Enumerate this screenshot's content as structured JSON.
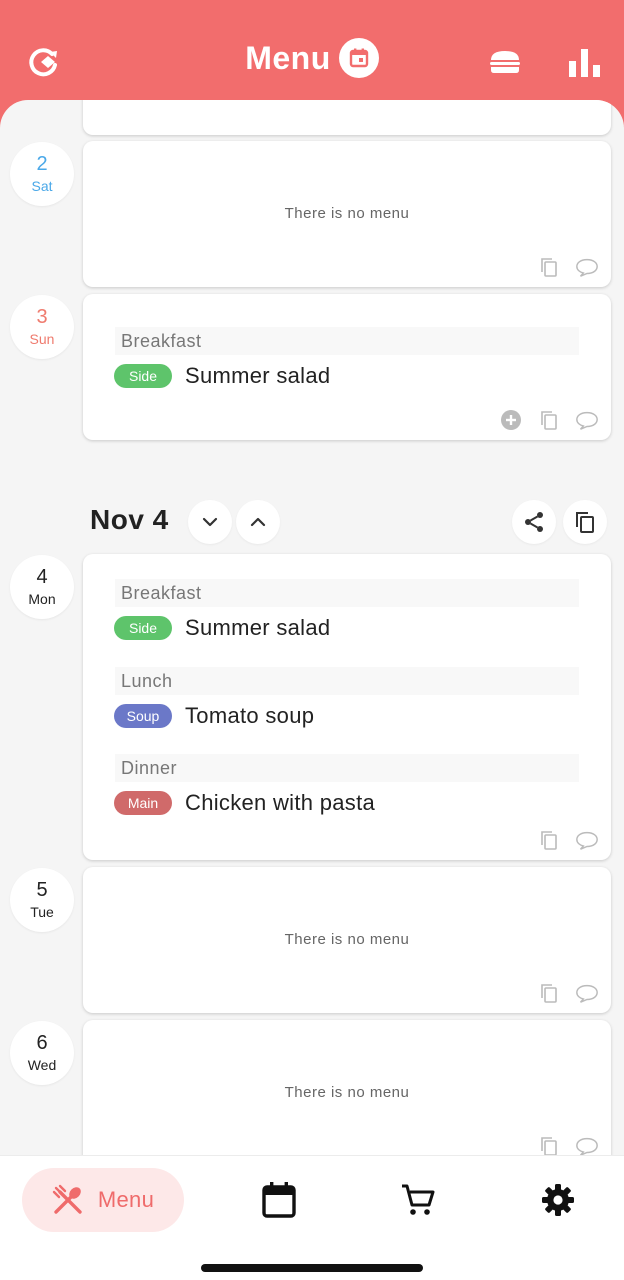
{
  "header": {
    "title": "Menu",
    "icons": {
      "left": "refresh-diamond-icon",
      "title": "calendar-badge-icon",
      "burger": "burger-icon",
      "stats": "bar-chart-icon"
    }
  },
  "days": [
    {
      "num": "2",
      "weekday": "Sat",
      "empty_text": "There is no menu"
    },
    {
      "num": "3",
      "weekday": "Sun",
      "meals": [
        {
          "label": "Breakfast",
          "tag": "Side",
          "dish": "Summer salad"
        }
      ]
    },
    {
      "num": "4",
      "weekday": "Mon",
      "meals": [
        {
          "label": "Breakfast",
          "tag": "Side",
          "dish": "Summer salad"
        },
        {
          "label": "Lunch",
          "tag": "Soup",
          "dish": "Tomato soup"
        },
        {
          "label": "Dinner",
          "tag": "Main",
          "dish": "Chicken with pasta"
        }
      ]
    },
    {
      "num": "5",
      "weekday": "Tue",
      "empty_text": "There is no menu"
    },
    {
      "num": "6",
      "weekday": "Wed",
      "empty_text": "There is no menu"
    }
  ],
  "week": {
    "title": "Nov 4"
  },
  "bottom_nav": {
    "active_label": "Menu"
  },
  "colors": {
    "brand": "#f26d6d",
    "saturday": "#4aa8e8",
    "sunday": "#ef7b6e",
    "tag_side": "#5ec46b",
    "tag_soup": "#6b78c8",
    "tag_main": "#d06a6a"
  }
}
